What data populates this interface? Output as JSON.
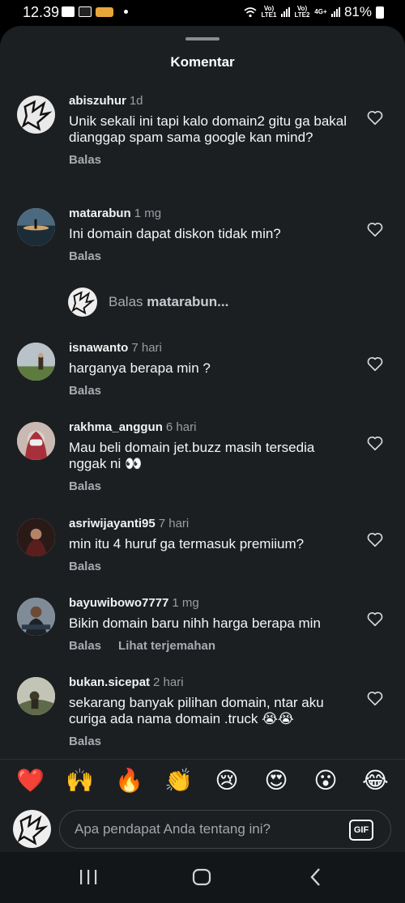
{
  "status_bar": {
    "time": "12.39",
    "battery": "81%",
    "sim1_tag": "Vo) LTE1",
    "sim2_tag": "Vo) LTE2",
    "network": "4G+"
  },
  "sheet": {
    "title": "Komentar"
  },
  "comments": [
    {
      "username": "abiszuhur",
      "time": "1d",
      "text": "Unik sekali ini tapi kalo domain2 gitu ga bakal dianggap spam sama google kan mind?",
      "reply_label": "Balas"
    },
    {
      "username": "matarabun",
      "time": "1 mg",
      "text": "Ini domain dapat diskon tidak min?",
      "reply_label": "Balas"
    },
    {
      "username": "isnawanto",
      "time": "7 hari",
      "text": "harganya berapa min ?",
      "reply_label": "Balas"
    },
    {
      "username": "rakhma_anggun",
      "time": "6 hari",
      "text": "Mau beli domain jet.buzz masih tersedia nggak ni 👀",
      "reply_label": "Balas"
    },
    {
      "username": "asriwijayanti95",
      "time": "7 hari",
      "text": "min itu 4 huruf ga termasuk premiium?",
      "reply_label": "Balas"
    },
    {
      "username": "bayuwibowo7777",
      "time": "1 mg",
      "text": "Bikin domain baru nihh harga berapa min",
      "reply_label": "Balas",
      "translate_label": "Lihat terjemahan"
    },
    {
      "username": "bukan.sicepat",
      "time": "2 hari",
      "text": "sekarang banyak pilihan domain, ntar aku curiga ada nama domain .truck 😭😭",
      "reply_label": "Balas"
    }
  ],
  "reply_prompt": {
    "prefix": "Balas",
    "target": "matarabun..."
  },
  "emoji_bar": [
    "❤️",
    "🙌",
    "🔥",
    "👏",
    "😢",
    "😍",
    "😮",
    "😂"
  ],
  "compose": {
    "placeholder": "Apa pendapat Anda tentang ini?",
    "gif_label": "GIF"
  },
  "colors": {
    "sheet_bg": "#1b1f22",
    "muted_text": "#9a9ea2",
    "text": "#f5f5f5"
  },
  "icons": {
    "heart": "heart-outline-icon",
    "nav_recents": "recents-icon",
    "nav_home": "home-icon",
    "nav_back": "back-icon"
  }
}
